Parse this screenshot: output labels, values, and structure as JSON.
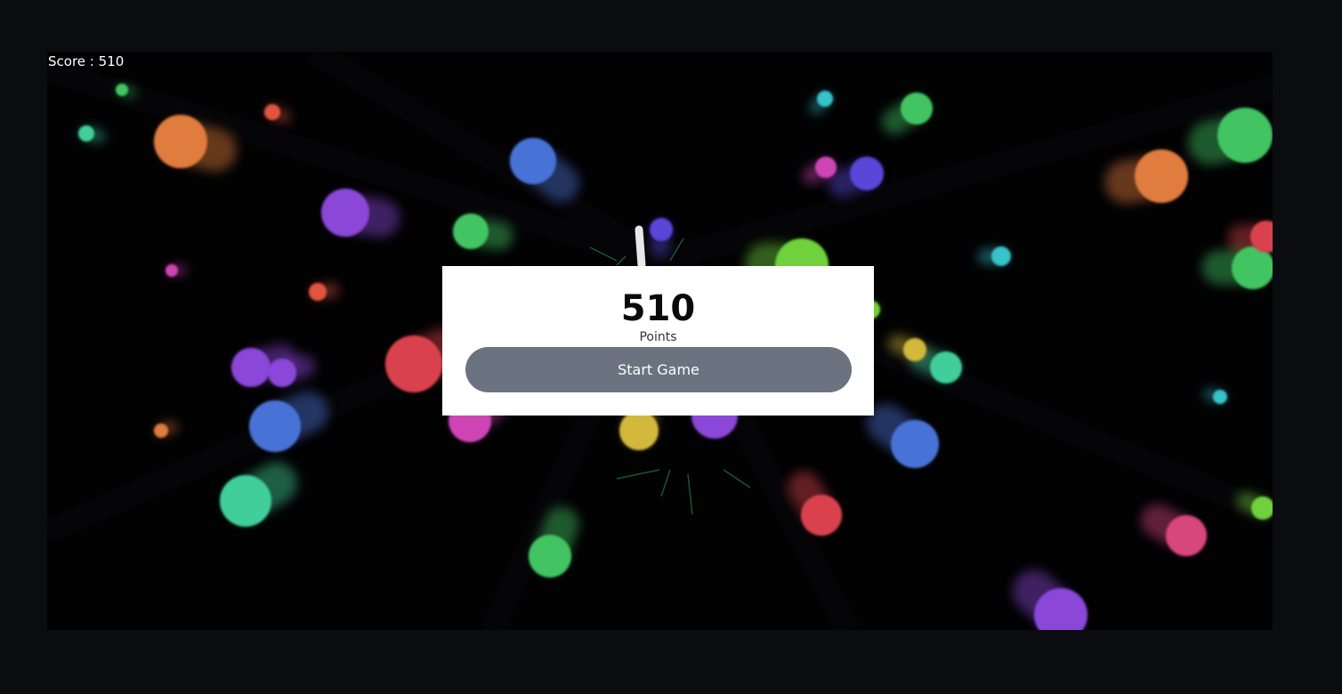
{
  "hud": {
    "score_text": "Score : 510"
  },
  "game_over": {
    "score_value": "510",
    "points_label": "Points",
    "start_button_label": "Start Game"
  },
  "colors": {
    "background": "#0b0c10",
    "playfield": "#020203",
    "button": "#6b7280",
    "panel": "#ffffff",
    "orb_palette": [
      "#e07b3c",
      "#4a72d6",
      "#8a46d8",
      "#42c463",
      "#3fcf9c",
      "#d9434d",
      "#cf45b6",
      "#d2b83a",
      "#38c2c9",
      "#5b45d9",
      "#d7477a",
      "#6fd13c",
      "#e0543e"
    ]
  }
}
